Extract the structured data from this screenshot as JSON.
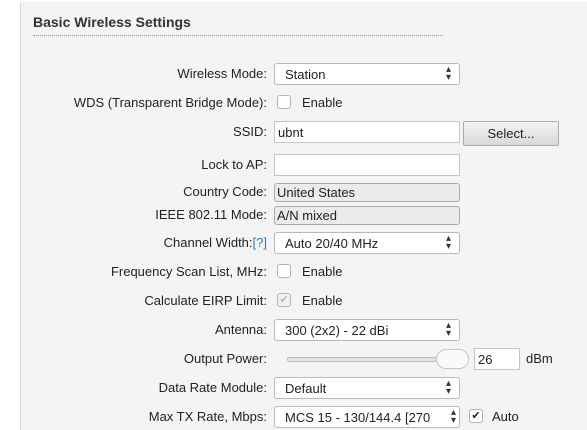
{
  "section_title": "Basic Wireless Settings",
  "wireless_mode": {
    "label": "Wireless Mode:",
    "value": "Station"
  },
  "wds": {
    "label": "WDS (Transparent Bridge Mode):",
    "checkbox_label": "Enable",
    "checked": false
  },
  "ssid": {
    "label": "SSID:",
    "value": "ubnt",
    "select_button": "Select..."
  },
  "lock_to_ap": {
    "label": "Lock to AP:",
    "value": ""
  },
  "country_code": {
    "label": "Country Code:",
    "value": "United States"
  },
  "ieee_mode": {
    "label": "IEEE 802.11 Mode:",
    "value": "A/N mixed"
  },
  "channel_width": {
    "label": "Channel Width:",
    "help": "[?]",
    "value": "Auto 20/40 MHz"
  },
  "freq_scan": {
    "label": "Frequency Scan List, MHz:",
    "checkbox_label": "Enable",
    "checked": false
  },
  "eirp": {
    "label": "Calculate EIRP Limit:",
    "checkbox_label": "Enable",
    "checked": true,
    "disabled": true
  },
  "antenna": {
    "label": "Antenna:",
    "value": "300 (2x2) - 22 dBi"
  },
  "output_power": {
    "label": "Output Power:",
    "value": "26",
    "unit": "dBm",
    "slider_level": 0.95
  },
  "data_rate_module": {
    "label": "Data Rate Module:",
    "value": "Default"
  },
  "max_tx_rate": {
    "label": "Max TX Rate, Mbps:",
    "value": "MCS 15 - 130/144.4 [270",
    "auto_label": "Auto",
    "auto_checked": true
  },
  "icons": {
    "select_arrows": "updown-arrows-icon",
    "check": "check-icon"
  }
}
